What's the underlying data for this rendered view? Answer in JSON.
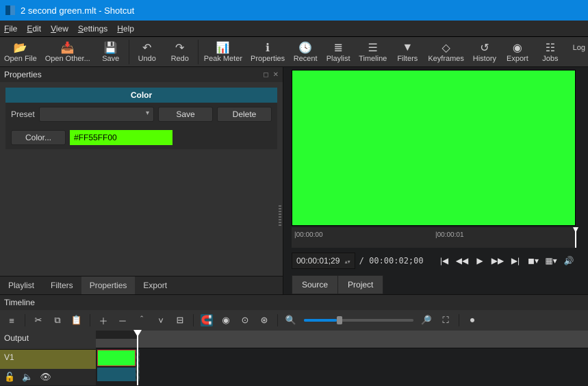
{
  "window": {
    "title": "2 second green.mlt - Shotcut"
  },
  "menu": {
    "file": "File",
    "edit": "Edit",
    "view": "View",
    "settings": "Settings",
    "help": "Help"
  },
  "toolbar": {
    "open_file": "Open File",
    "open_other": "Open Other...",
    "save": "Save",
    "undo": "Undo",
    "redo": "Redo",
    "peak_meter": "Peak Meter",
    "properties": "Properties",
    "recent": "Recent",
    "playlist": "Playlist",
    "timeline": "Timeline",
    "filters": "Filters",
    "keyframes": "Keyframes",
    "history": "History",
    "export": "Export",
    "jobs": "Jobs",
    "log": "Log"
  },
  "properties": {
    "panel_title": "Properties",
    "header": "Color",
    "preset_label": "Preset",
    "save_btn": "Save",
    "delete_btn": "Delete",
    "color_btn": "Color...",
    "color_value": "#FF55FF00",
    "color_swatch": "#55FF00"
  },
  "left_tabs": {
    "playlist": "Playlist",
    "filters": "Filters",
    "properties": "Properties",
    "export": "Export"
  },
  "preview": {
    "color": "#29fd2f",
    "ruler_start": "|00:00:00",
    "ruler_mid": "|00:00:01",
    "timecode": "00:00:01;29",
    "duration": "/ 00:00:02;00"
  },
  "source_tabs": {
    "source": "Source",
    "project": "Project"
  },
  "timeline": {
    "title": "Timeline",
    "output": "Output",
    "track": "V1"
  }
}
